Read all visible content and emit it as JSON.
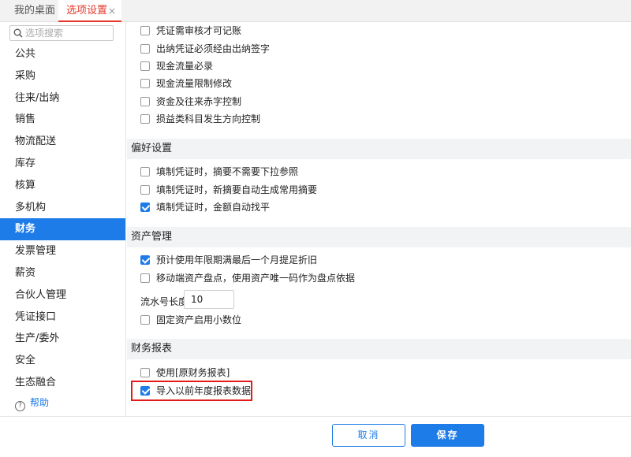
{
  "tabs": {
    "home": "我的桌面",
    "active": "选项设置",
    "close": "×"
  },
  "sidebar": {
    "search_placeholder": "选项搜索",
    "items": [
      {
        "label": "公共"
      },
      {
        "label": "采购"
      },
      {
        "label": "往来/出纳"
      },
      {
        "label": "销售"
      },
      {
        "label": "物流配送"
      },
      {
        "label": "库存"
      },
      {
        "label": "核算"
      },
      {
        "label": "多机构"
      },
      {
        "label": "财务"
      },
      {
        "label": "发票管理"
      },
      {
        "label": "薪资"
      },
      {
        "label": "合伙人管理"
      },
      {
        "label": "凭证接口"
      },
      {
        "label": "生产/委外"
      },
      {
        "label": "安全"
      },
      {
        "label": "生态融合"
      }
    ],
    "active_item": "财务",
    "help_label": "帮助",
    "help_icon": "?"
  },
  "main": {
    "top_options": [
      {
        "label": "凭证需审核才可记账",
        "checked": false
      },
      {
        "label": "出纳凭证必须经由出纳签字",
        "checked": false
      },
      {
        "label": "现金流量必录",
        "checked": false
      },
      {
        "label": "现金流量限制修改",
        "checked": false
      },
      {
        "label": "资金及往来赤字控制",
        "checked": false
      },
      {
        "label": "损益类科目发生方向控制",
        "checked": false
      }
    ],
    "preferences": {
      "title": "偏好设置",
      "options": [
        {
          "label": "填制凭证时，摘要不需要下拉参照",
          "checked": false
        },
        {
          "label": "填制凭证时，新摘要自动生成常用摘要",
          "checked": false
        },
        {
          "label": "填制凭证时，金额自动找平",
          "checked": true
        }
      ]
    },
    "assets": {
      "title": "资产管理",
      "options": [
        {
          "label": "预计使用年限期满最后一个月提足折旧",
          "checked": true
        },
        {
          "label": "移动端资产盘点，使用资产唯一码作为盘点依据",
          "checked": false
        }
      ],
      "serial_label": "流水号长度",
      "serial_value": "10",
      "decimal_option": {
        "label": "固定资产启用小数位",
        "checked": false
      }
    },
    "reports": {
      "title": "财务报表",
      "options": [
        {
          "label": "使用[原财务报表]",
          "checked": false
        },
        {
          "label": "导入以前年度报表数据",
          "checked": true
        }
      ]
    }
  },
  "footer": {
    "cancel_label": "取消",
    "save_label": "保存"
  },
  "colors": {
    "accent": "#1e7ce8",
    "tab_active": "#e5382b",
    "highlight_box": "#e31b1b"
  }
}
